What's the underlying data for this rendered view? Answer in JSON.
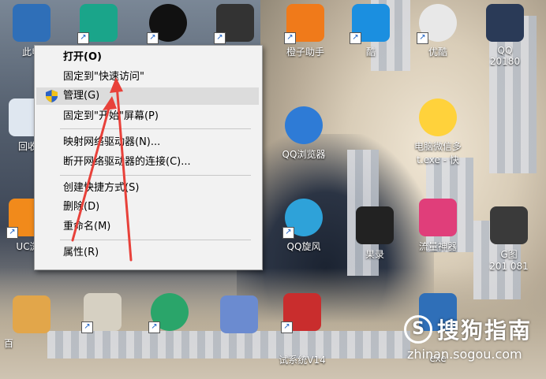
{
  "desktop": {
    "icons": [
      {
        "label": "此电",
        "color": "#2f6fb8"
      },
      {
        "label": "",
        "color": "#1aa58a"
      },
      {
        "label": "",
        "color": "#111111"
      },
      {
        "label": "",
        "color": "#333333"
      },
      {
        "label": "橙子助手",
        "color": "#f07a1a"
      },
      {
        "label": "酷",
        "color": "#1b8fe0"
      },
      {
        "label": "优酷",
        "color": "#e8e8e8"
      },
      {
        "label": "QQ",
        "color": "#2a3a57"
      },
      {
        "label": "回收",
        "color": "#dfe7f0"
      },
      {
        "label": "QQ浏览器",
        "color": "#2e7bd6"
      },
      {
        "label": "电脑微信多",
        "color": "#ffd23b"
      },
      {
        "label": "UC浏",
        "color": "#f18a1b"
      },
      {
        "label": "QQ旋风",
        "color": "#2ea2d9"
      },
      {
        "label": "流量神器",
        "color": "#e03e7a"
      },
      {
        "label": "试系统V14",
        "color": "#c92d2d"
      },
      {
        "label": "exe",
        "color": "#2f6fb8"
      },
      {
        "label": "百",
        "color": "#e2a64a"
      },
      {
        "label": "",
        "color": "#2aa56a"
      }
    ],
    "labels_extra": {
      "line2_qq": "20180",
      "line2_wechat": "t.exe - 快",
      "pictures": "G图",
      "pictures_sub": "201 081",
      "music": "果录"
    }
  },
  "context_menu": {
    "items": [
      {
        "label": "打开(O)",
        "bold": true
      },
      {
        "label": "固定到\"快速访问\""
      },
      {
        "label": "管理(G)",
        "highlighted": true,
        "icon": "uac-shield-icon"
      },
      {
        "label": "固定到\"开始\"屏幕(P)"
      },
      {
        "label": "映射网络驱动器(N)..."
      },
      {
        "label": "断开网络驱动器的连接(C)..."
      },
      {
        "label": "创建快捷方式(S)"
      },
      {
        "label": "删除(D)"
      },
      {
        "label": "重命名(M)"
      },
      {
        "label": "属性(R)"
      }
    ]
  },
  "watermark": {
    "logo": "S",
    "title": "搜狗指南",
    "url": "zhinan.sogou.com"
  },
  "colors": {
    "arrow": "#e8413a",
    "menu_bg": "#f2f2f2",
    "menu_hover": "#dcdcdc"
  }
}
